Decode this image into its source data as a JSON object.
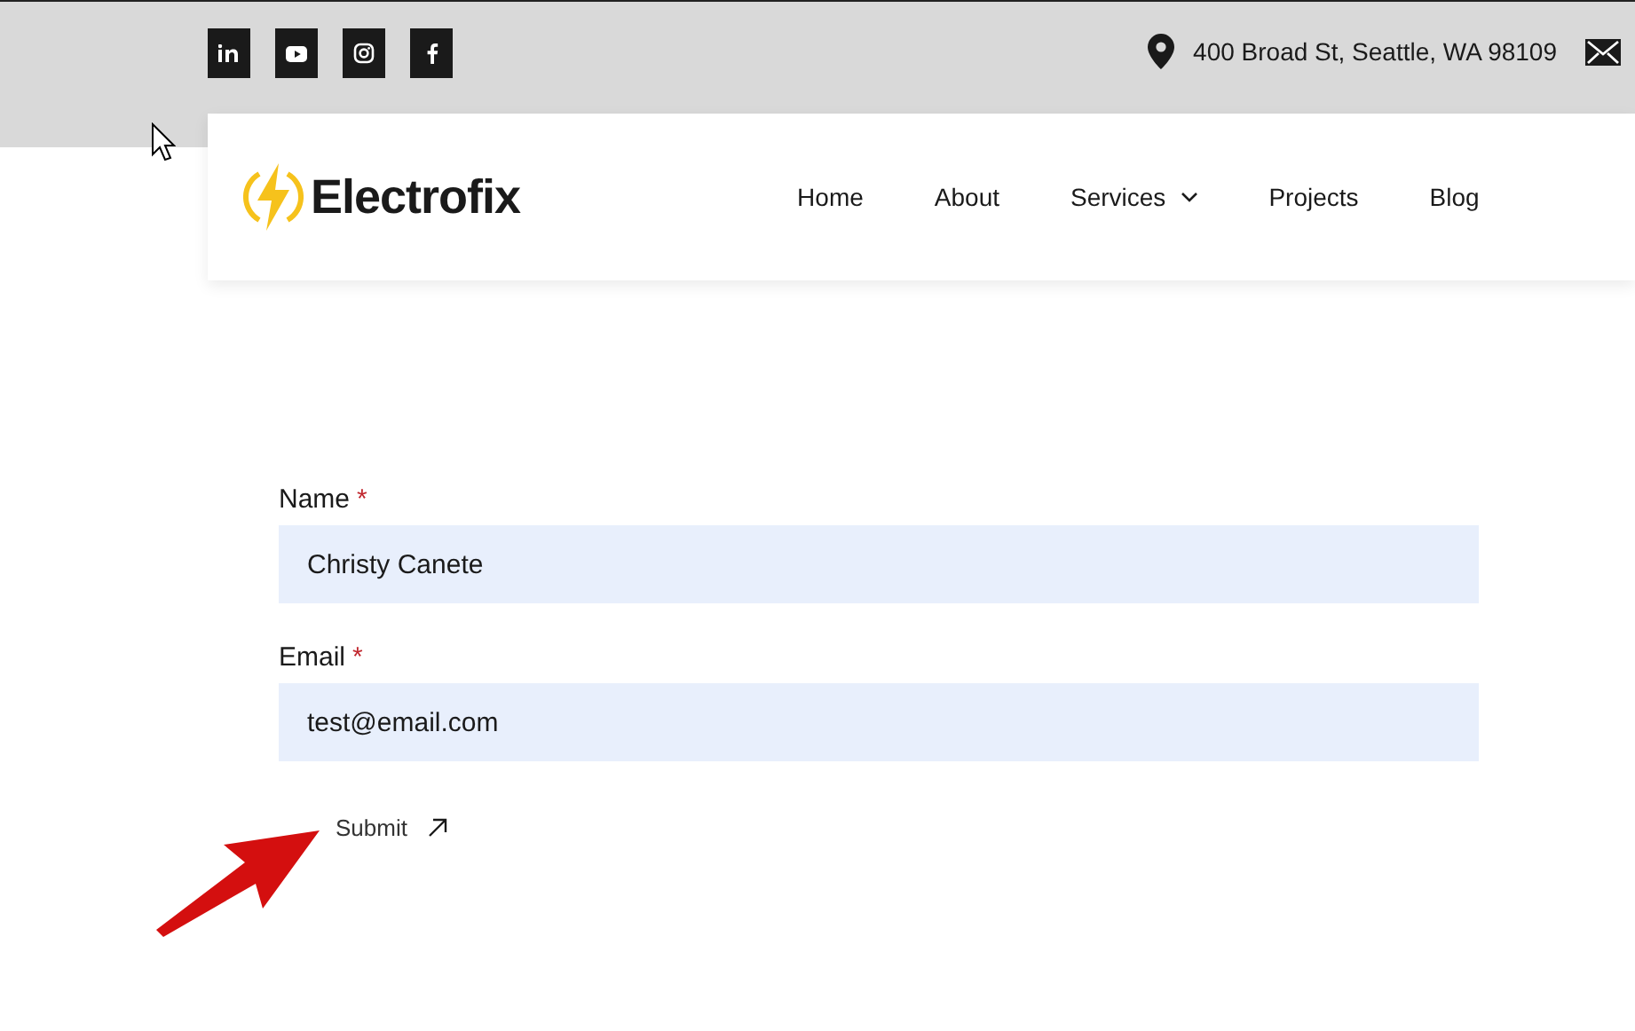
{
  "topbar": {
    "socials": [
      {
        "kind": "linkedin"
      },
      {
        "kind": "youtube"
      },
      {
        "kind": "instagram"
      },
      {
        "kind": "facebook"
      }
    ],
    "address": "400 Broad St, Seattle, WA 98109"
  },
  "header": {
    "logo": "Electrofix",
    "nav": [
      {
        "label": "Home",
        "dropdown": false
      },
      {
        "label": "About",
        "dropdown": false
      },
      {
        "label": "Services",
        "dropdown": true
      },
      {
        "label": "Projects",
        "dropdown": false
      },
      {
        "label": "Blog",
        "dropdown": false
      }
    ]
  },
  "form": {
    "fields": [
      {
        "label": "Name",
        "required_mark": "*",
        "value": "Christy Canete"
      },
      {
        "label": "Email",
        "required_mark": "*",
        "value": "test@email.com"
      }
    ],
    "submit": "Submit"
  }
}
